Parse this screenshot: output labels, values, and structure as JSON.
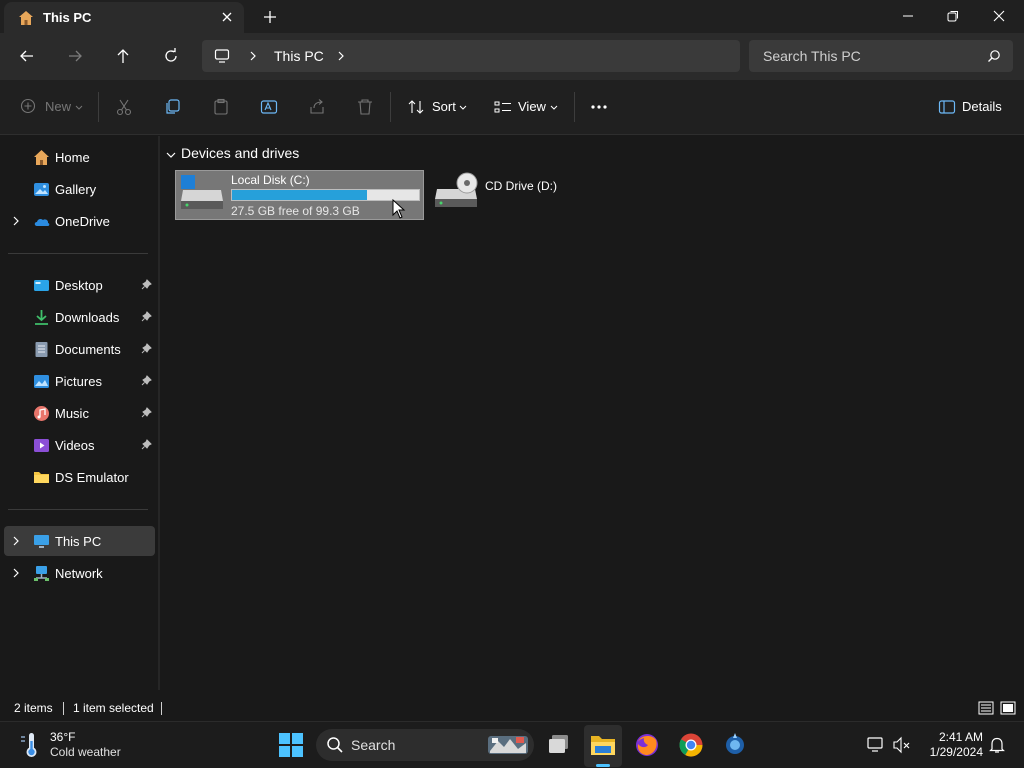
{
  "window": {
    "tab_title": "This PC",
    "controls": [
      "minimize",
      "restore",
      "close"
    ]
  },
  "address_bar": {
    "path": "This PC",
    "search_placeholder": "Search This PC"
  },
  "command_bar": {
    "new_label": "New",
    "sort_label": "Sort",
    "view_label": "View",
    "details_label": "Details"
  },
  "sidebar": {
    "top_items": [
      {
        "label": "Home",
        "icon": "home-icon"
      },
      {
        "label": "Gallery",
        "icon": "gallery-icon"
      },
      {
        "label": "OneDrive",
        "icon": "onedrive-icon",
        "expandable": true
      }
    ],
    "quick_access": [
      {
        "label": "Desktop",
        "icon": "desktop-icon",
        "pinned": true
      },
      {
        "label": "Downloads",
        "icon": "downloads-icon",
        "pinned": true
      },
      {
        "label": "Documents",
        "icon": "documents-icon",
        "pinned": true
      },
      {
        "label": "Pictures",
        "icon": "pictures-icon",
        "pinned": true
      },
      {
        "label": "Music",
        "icon": "music-icon",
        "pinned": true
      },
      {
        "label": "Videos",
        "icon": "videos-icon",
        "pinned": true
      },
      {
        "label": "DS Emulator",
        "icon": "folder-icon",
        "pinned": false
      }
    ],
    "bottom_items": [
      {
        "label": "This PC",
        "icon": "pc-icon",
        "selected": true
      },
      {
        "label": "Network",
        "icon": "network-icon"
      }
    ]
  },
  "main": {
    "section_title": "Devices and drives",
    "drives": [
      {
        "name": "Local Disk (C:)",
        "free_text": "27.5 GB free of 99.3 GB",
        "used_fraction": 0.723,
        "selected": true
      },
      {
        "name": "CD Drive (D:)"
      }
    ]
  },
  "status_bar": {
    "item_count": "2 items",
    "selection": "1 item selected"
  },
  "taskbar": {
    "weather_temp": "36°F",
    "weather_desc": "Cold weather",
    "search_label": "Search",
    "time": "2:41 AM",
    "date": "1/29/2024"
  },
  "colors": {
    "accent": "#26a0da",
    "selection": "#777777",
    "folder": "#f4c542"
  }
}
